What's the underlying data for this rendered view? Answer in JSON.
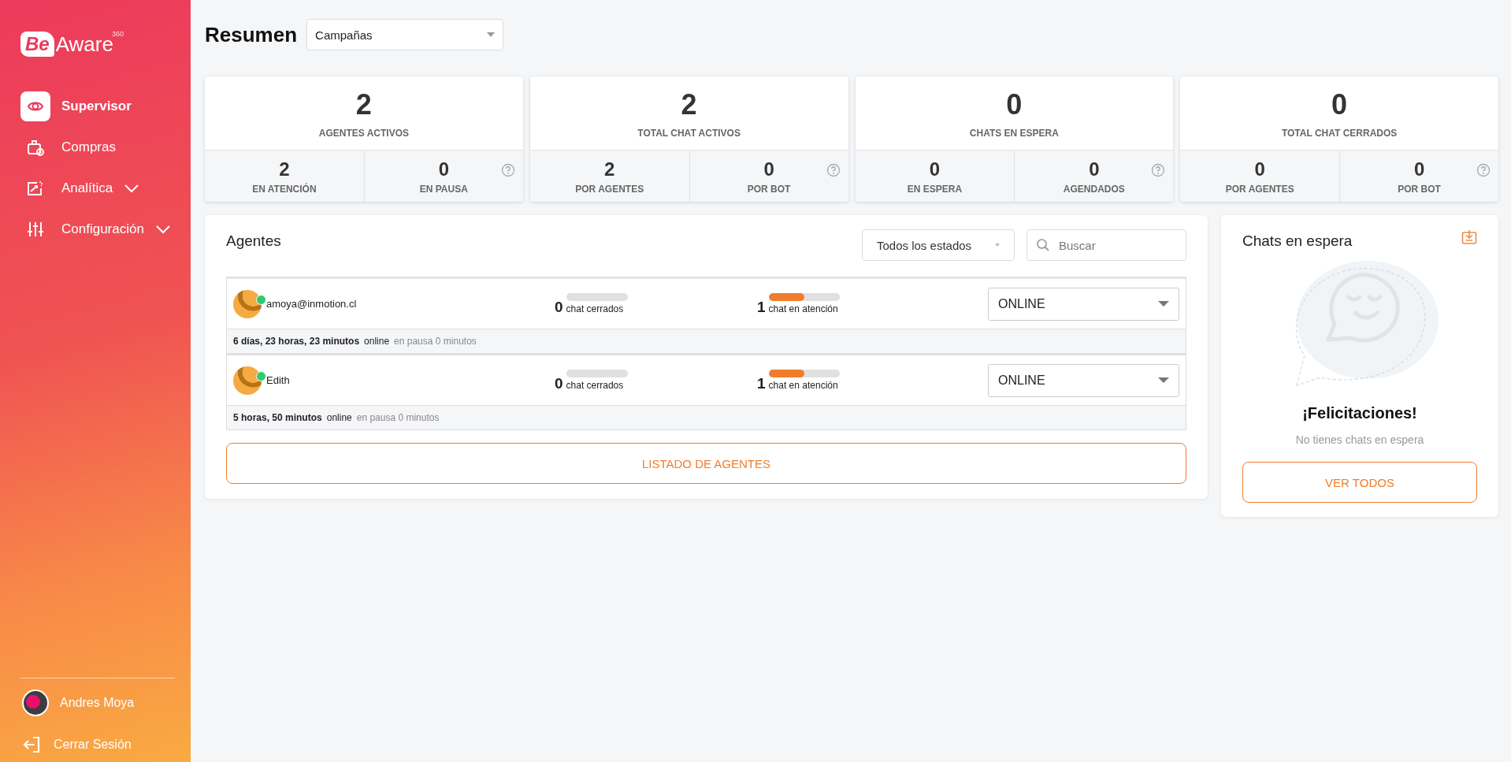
{
  "sidebar": {
    "logo": {
      "be": "Be",
      "aware": "Aware",
      "superscript": "360"
    },
    "items": [
      {
        "label": "Supervisor",
        "selected": true,
        "kind": "link"
      },
      {
        "label": "Compras",
        "selected": false,
        "kind": "link"
      },
      {
        "label": "Analítica",
        "selected": false,
        "kind": "group"
      },
      {
        "label": "Configuración",
        "selected": false,
        "kind": "group"
      }
    ],
    "user": {
      "name": "Andres Moya"
    },
    "logout": "Cerrar Sesión"
  },
  "header": {
    "title": "Resumen",
    "dropdown": "Campañas"
  },
  "stats": [
    {
      "value": "2",
      "label": "AGENTES ACTIVOS",
      "sub": [
        {
          "value": "2",
          "label": "EN ATENCIÓN"
        },
        {
          "value": "0",
          "label": "EN PAUSA"
        }
      ]
    },
    {
      "value": "2",
      "label": "TOTAL CHAT ACTIVOS",
      "sub": [
        {
          "value": "2",
          "label": "POR AGENTES"
        },
        {
          "value": "0",
          "label": "POR BOT"
        }
      ]
    },
    {
      "value": "0",
      "label": "CHATS EN ESPERA",
      "sub": [
        {
          "value": "0",
          "label": "EN ESPERA"
        },
        {
          "value": "0",
          "label": "AGENDADOS"
        }
      ]
    },
    {
      "value": "0",
      "label": "TOTAL CHAT CERRADOS",
      "sub": [
        {
          "value": "0",
          "label": "POR AGENTES"
        },
        {
          "value": "0",
          "label": "POR BOT"
        }
      ]
    }
  ],
  "agents": {
    "title": "Agentes",
    "filter": "Todos los estados",
    "search": {
      "placeholder": "Buscar"
    },
    "rows": [
      {
        "name": "amoya@inmotion.cl",
        "online": true,
        "closed": {
          "count": "0",
          "label": "chat cerrados",
          "level": 0
        },
        "attending": {
          "count": "1",
          "label": "chat en atención",
          "level": 0.5
        },
        "status": "ONLINE",
        "duration": "6 días, 23 horas, 23 minutos",
        "state": "online",
        "pause": "en pausa 0 minutos"
      },
      {
        "name": "Edith",
        "online": true,
        "closed": {
          "count": "0",
          "label": "chat cerrados",
          "level": 0
        },
        "attending": {
          "count": "1",
          "label": "chat en atención",
          "level": 0.5
        },
        "status": "ONLINE",
        "duration": "5 horas, 50 minutos",
        "state": "online",
        "pause": "en pausa 0 minutos"
      }
    ],
    "button": "LISTADO DE AGENTES"
  },
  "waiting": {
    "title": "Chats en espera",
    "heading": "¡Felicitaciones!",
    "message": "No tienes chats en espera",
    "button": "VER TODOS"
  }
}
